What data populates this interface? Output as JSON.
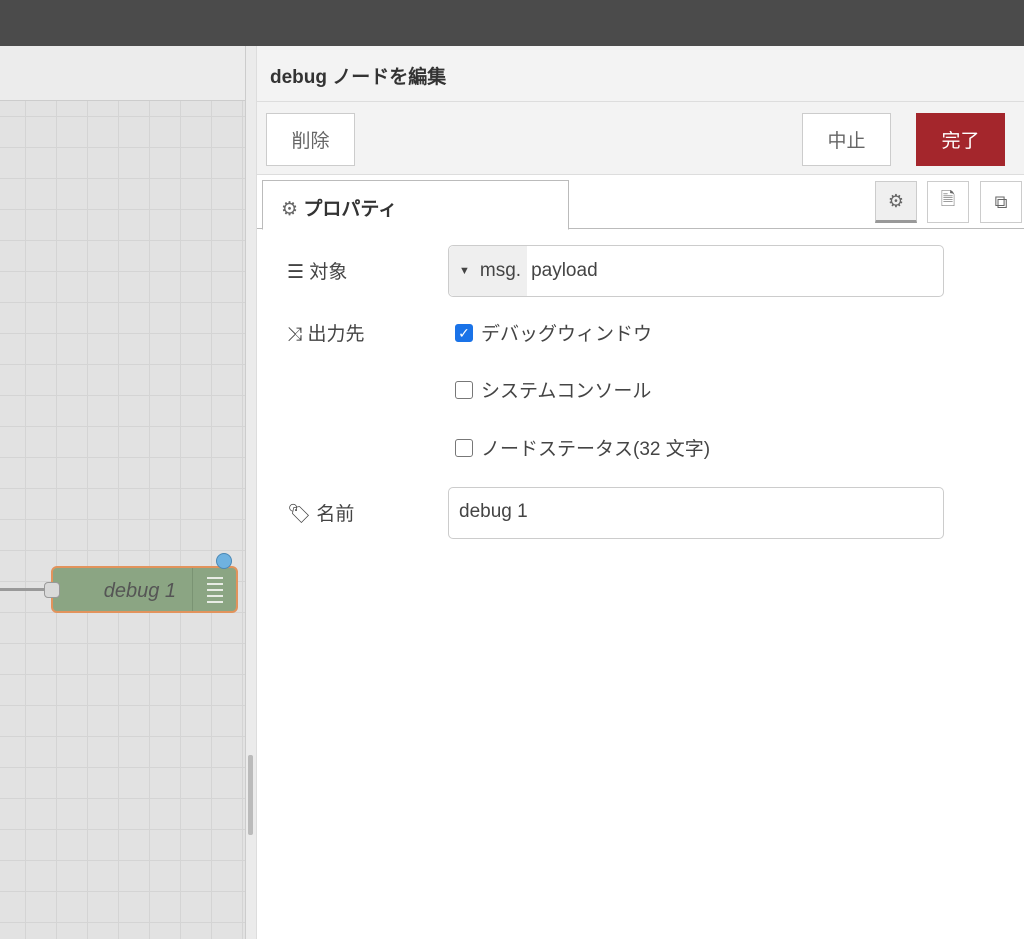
{
  "panel": {
    "title": "debug ノードを編集",
    "delete_label": "削除",
    "cancel_label": "中止",
    "done_label": "完了",
    "tab_label": "プロパティ"
  },
  "form": {
    "target_label": "対象",
    "target_prefix": "msg.",
    "target_value": "payload",
    "output_label": "出力先",
    "outputs": [
      {
        "label": "デバッグウィンドウ",
        "checked": true
      },
      {
        "label": "システムコンソール",
        "checked": false
      },
      {
        "label": "ノードステータス(32 文字)",
        "checked": false
      }
    ],
    "name_label": "名前",
    "name_value": "debug 1"
  },
  "canvas": {
    "node_label": "debug 1"
  },
  "colors": {
    "done": "#a4262c",
    "node": "#8ba583",
    "node_border": "#e2935c"
  }
}
